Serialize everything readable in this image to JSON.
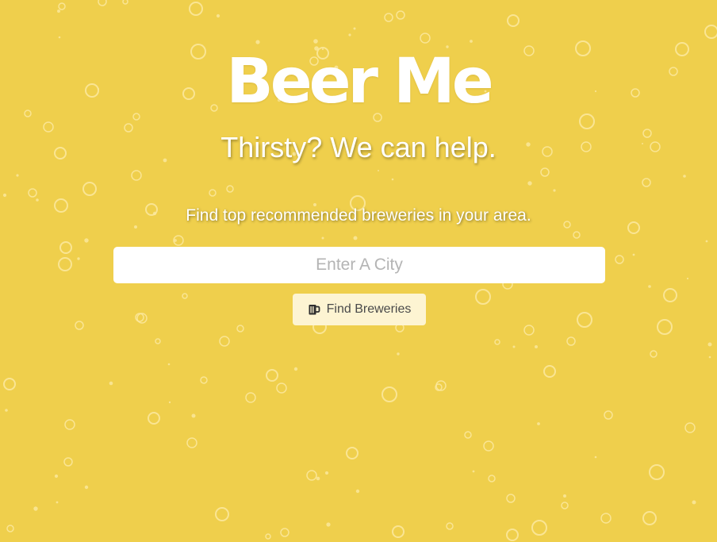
{
  "header": {
    "title": "Beer Me",
    "tagline": "Thirsty? We can help.",
    "description": "Find top recommended breweries in your area."
  },
  "search": {
    "placeholder": "Enter A City",
    "value": ""
  },
  "actions": {
    "find_label": "Find Breweries",
    "find_icon": "beer-mug-icon"
  },
  "theme": {
    "background": "#efcf4c",
    "bubble": "#fbe9a0",
    "button_bg": "#fdf4d2",
    "text": "#ffffff"
  }
}
